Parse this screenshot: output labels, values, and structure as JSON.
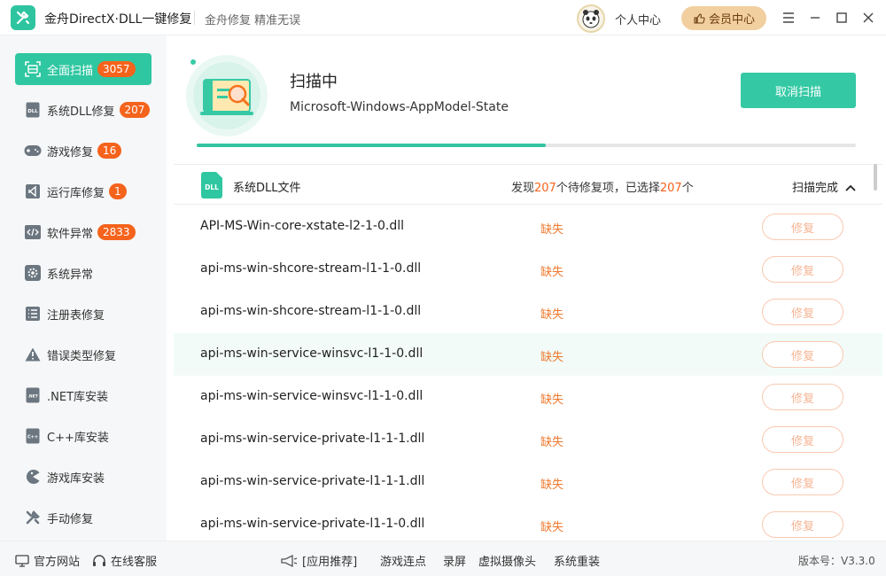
{
  "app": {
    "title": "金舟DirectX·DLL一键修复",
    "slogan": "金舟修复 精准无误",
    "user_center": "个人中心",
    "vip": "会员中心"
  },
  "sidebar": {
    "items": [
      {
        "label": "全面扫描",
        "badge": "3057",
        "icon": "scan-icon"
      },
      {
        "label": "系统DLL修复",
        "badge": "207",
        "icon": "dll-icon"
      },
      {
        "label": "游戏修复",
        "badge": "16",
        "icon": "gamepad-icon"
      },
      {
        "label": "运行库修复",
        "badge": "1",
        "icon": "visual-studio-icon"
      },
      {
        "label": "软件异常",
        "badge": "2833",
        "icon": "code-icon"
      },
      {
        "label": "系统异常",
        "badge": "",
        "icon": "gear-icon"
      },
      {
        "label": "注册表修复",
        "badge": "",
        "icon": "list-icon"
      },
      {
        "label": "错误类型修复",
        "badge": "",
        "icon": "warning-icon"
      },
      {
        "label": ".NET库安装",
        "badge": "",
        "icon": "dotnet-icon"
      },
      {
        "label": "C++库安装",
        "badge": "",
        "icon": "cpp-icon"
      },
      {
        "label": "游戏库安装",
        "badge": "",
        "icon": "pacman-icon"
      },
      {
        "label": "手动修复",
        "badge": "",
        "icon": "wrench-icon"
      }
    ]
  },
  "scan": {
    "title": "扫描中",
    "current_item": "Microsoft-Windows-AppModel-State",
    "cancel_label": "取消扫描",
    "progress": 0.53
  },
  "category": {
    "name": "系统DLL文件",
    "found_prefix": "发现",
    "found_count": "207",
    "found_mid": "个待修复项，已选择",
    "selected_count": "207",
    "found_suffix": "个",
    "status": "扫描完成"
  },
  "rows": [
    {
      "name": "API-MS-Win-core-xstate-l2-1-0.dll",
      "status": "缺失",
      "action": "修复"
    },
    {
      "name": "api-ms-win-shcore-stream-l1-1-0.dll",
      "status": "缺失",
      "action": "修复"
    },
    {
      "name": "api-ms-win-shcore-stream-l1-1-0.dll",
      "status": "缺失",
      "action": "修复"
    },
    {
      "name": "api-ms-win-service-winsvc-l1-1-0.dll",
      "status": "缺失",
      "action": "修复"
    },
    {
      "name": "api-ms-win-service-winsvc-l1-1-0.dll",
      "status": "缺失",
      "action": "修复"
    },
    {
      "name": "api-ms-win-service-private-l1-1-1.dll",
      "status": "缺失",
      "action": "修复"
    },
    {
      "name": "api-ms-win-service-private-l1-1-1.dll",
      "status": "缺失",
      "action": "修复"
    },
    {
      "name": "api-ms-win-service-private-l1-1-0.dll",
      "status": "缺失",
      "action": "修复"
    }
  ],
  "footer": {
    "official_site": "官方网站",
    "online_service": "在线客服",
    "recommend": "[应用推荐]",
    "links": [
      "游戏连点",
      "录屏",
      "虚拟摄像头",
      "系统重装"
    ],
    "version": "版本号：V3.3.0"
  },
  "colors": {
    "accent": "#2fc7a1",
    "badge": "#f5631c",
    "missing": "#f07a2e",
    "vip": "#f2cf9f"
  }
}
